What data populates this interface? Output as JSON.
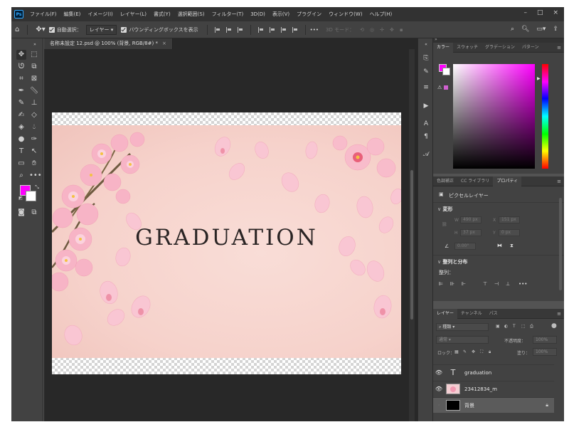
{
  "menu": {
    "logo": "Ps",
    "items": [
      "ファイル(F)",
      "編集(E)",
      "イメージ(I)",
      "レイヤー(L)",
      "書式(Y)",
      "選択範囲(S)",
      "フィルター(T)",
      "3D(D)",
      "表示(V)",
      "プラグイン",
      "ウィンドウ(W)",
      "ヘルプ(H)"
    ],
    "window_controls": [
      "–",
      "□",
      "×"
    ]
  },
  "options": {
    "auto_select_label": "自動選択：",
    "auto_select_value": "レイヤー",
    "bounding_box_label": "バウンディングボックスを表示",
    "more": "•••",
    "mode_3d_label": "3D モード："
  },
  "document": {
    "tab_title": "名称未設定 12.psd @ 100% (背景, RGB/8#) *",
    "canvas_text": "GRADUATION"
  },
  "panels": {
    "color_tabs": [
      "カラー",
      "スウォッチ",
      "グラデーション",
      "パターン"
    ],
    "prop_tabs": [
      "色調補正",
      "CC ライブラリ",
      "プロパティ"
    ],
    "pixel_layer_label": "ピクセルレイヤー",
    "transform_title": "変形",
    "w_label": "W",
    "w_value": "490 px",
    "x_label": "X",
    "x_value": "151 px",
    "h_label": "H",
    "h_value": "37 px",
    "y_value": "0 px",
    "angle_value": "0.00°",
    "align_title": "整列と分布",
    "align_label": "整列：",
    "layer_tabs": [
      "レイヤー",
      "チャンネル",
      "パス"
    ],
    "kind_filter": "種類",
    "blend_mode": "通常",
    "opacity_label": "不透明度：",
    "opacity_value": "100%",
    "lock_label": "ロック：",
    "fill_label": "塗り：",
    "fill_value": "100%"
  },
  "layers": [
    {
      "name": "graduation",
      "type": "text",
      "visible": true,
      "selected": false
    },
    {
      "name": "23412834_m",
      "type": "image",
      "visible": true,
      "selected": false
    },
    {
      "name": "背景",
      "type": "background",
      "visible": false,
      "selected": true,
      "locked": true
    }
  ],
  "colors": {
    "foreground": "#ff00ff",
    "background": "#ffffff",
    "app_dark": "#424242"
  }
}
